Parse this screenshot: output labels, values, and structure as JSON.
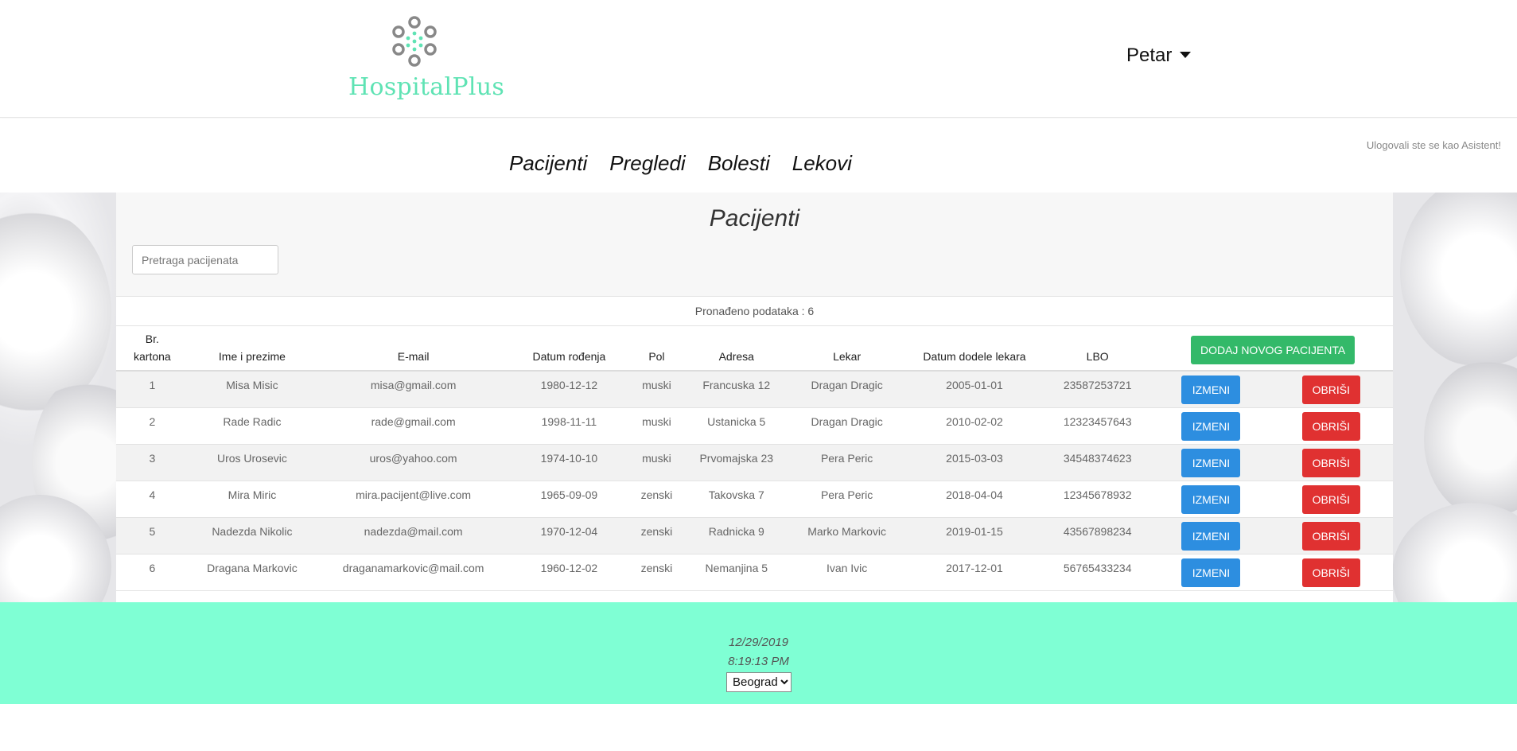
{
  "brand": {
    "name": "HospitalPlus",
    "accent_color": "#5fe3b4"
  },
  "user": {
    "name": "Petar"
  },
  "nav": {
    "items": [
      {
        "label": "Pacijenti"
      },
      {
        "label": "Pregledi"
      },
      {
        "label": "Bolesti"
      },
      {
        "label": "Lekovi"
      }
    ],
    "login_info": "Ulogovali ste se kao Asistent!"
  },
  "main": {
    "title": "Pacijenti",
    "search": {
      "placeholder": "Pretraga pacijenata",
      "value": ""
    },
    "found_text": "Pronađeno podataka : 6",
    "add_button": "DODAJ NOVOG PACIJENTA",
    "edit_label": "IZMENI",
    "delete_label": "OBRIŠI",
    "columns": [
      "Br. kartona",
      "Ime i prezime",
      "E-mail",
      "Datum rođenja",
      "Pol",
      "Adresa",
      "Lekar",
      "Datum dodele lekara",
      "LBO"
    ],
    "rows": [
      [
        "1",
        "Misa Misic",
        "misa@gmail.com",
        "1980-12-12",
        "muski",
        "Francuska 12",
        "Dragan Dragic",
        "2005-01-01",
        "23587253721"
      ],
      [
        "2",
        "Rade Radic",
        "rade@gmail.com",
        "1998-11-11",
        "muski",
        "Ustanicka 5",
        "Dragan Dragic",
        "2010-02-02",
        "12323457643"
      ],
      [
        "3",
        "Uros Urosevic",
        "uros@yahoo.com",
        "1974-10-10",
        "muski",
        "Prvomajska 23",
        "Pera Peric",
        "2015-03-03",
        "34548374623"
      ],
      [
        "4",
        "Mira Miric",
        "mira.pacijent@live.com",
        "1965-09-09",
        "zenski",
        "Takovska 7",
        "Pera Peric",
        "2018-04-04",
        "12345678932"
      ],
      [
        "5",
        "Nadezda Nikolic",
        "nadezda@mail.com",
        "1970-12-04",
        "zenski",
        "Radnicka 9",
        "Marko Markovic",
        "2019-01-15",
        "43567898234"
      ],
      [
        "6",
        "Dragana Markovic",
        "draganamarkovic@mail.com",
        "1960-12-02",
        "zenski",
        "Nemanjina 5",
        "Ivan Ivic",
        "2017-12-01",
        "56765433234"
      ]
    ],
    "colors": {
      "edit": "#2d8ee0",
      "delete": "#e03131",
      "add": "#33b969"
    }
  },
  "footer": {
    "date": "12/29/2019",
    "time": "8:19:13 PM",
    "city_selected": "Beograd",
    "bg_color": "#7fffd4"
  }
}
